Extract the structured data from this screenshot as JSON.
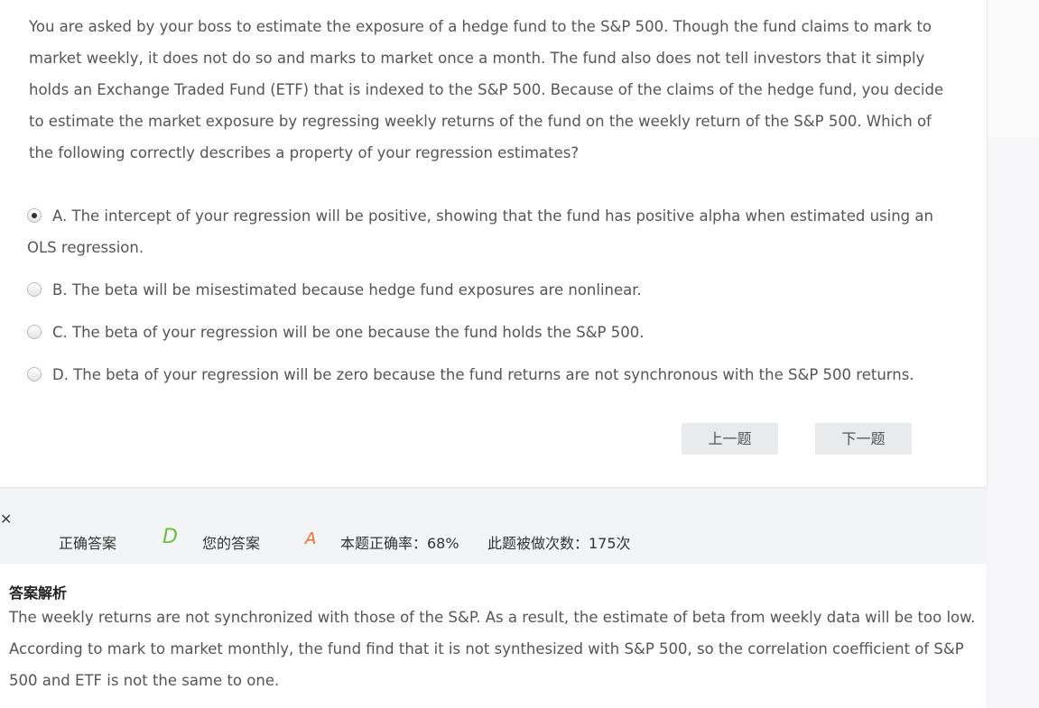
{
  "question": {
    "text": "You are asked by your boss to estimate the exposure of a hedge fund to the S&P 500. Though the fund claims to mark to market weekly, it does not do so and marks to market once a month. The fund also does not tell investors that it simply holds an Exchange Traded Fund (ETF) that is indexed to the S&P 500. Because of the claims of the hedge fund, you decide to estimate the market exposure by regressing weekly returns of the fund on the weekly return of the S&P 500. Which of the following correctly describes a property of your regression estimates?"
  },
  "options": [
    {
      "label": "A. The intercept of your regression will be positive, showing that the fund has positive alpha when estimated using an OLS regression.",
      "selected": true
    },
    {
      "label": "B. The beta will be misestimated because hedge fund exposures are nonlinear.",
      "selected": false
    },
    {
      "label": "C. The beta of your regression will be one because the fund holds the S&P 500.",
      "selected": false
    },
    {
      "label": "D. The beta of your regression will be zero because the fund returns are not synchronous with the S&P 500 returns.",
      "selected": false
    }
  ],
  "nav": {
    "prev_label": "上一题",
    "next_label": "下一题"
  },
  "result": {
    "status_icon": "wrong-x-icon",
    "correct_label": "正确答案",
    "correct_answer": "D",
    "your_label": "您的答案",
    "your_answer": "A",
    "accuracy_text": "本题正确率：68%",
    "attempts_text": "此题被做次数：175次",
    "colors": {
      "wrong": "#f36b2a",
      "correct": "#6cbf3c",
      "your": "#f36b2a"
    }
  },
  "analysis": {
    "title": "答案解析",
    "text": "The weekly returns are not synchronized with those of the S&P. As a result, the estimate of beta from weekly data will be too low. According to mark to market monthly, the fund find that it is not synthesized with S&P 500, so the correlation coefficient of S&P 500 and ETF is not the same to one."
  }
}
